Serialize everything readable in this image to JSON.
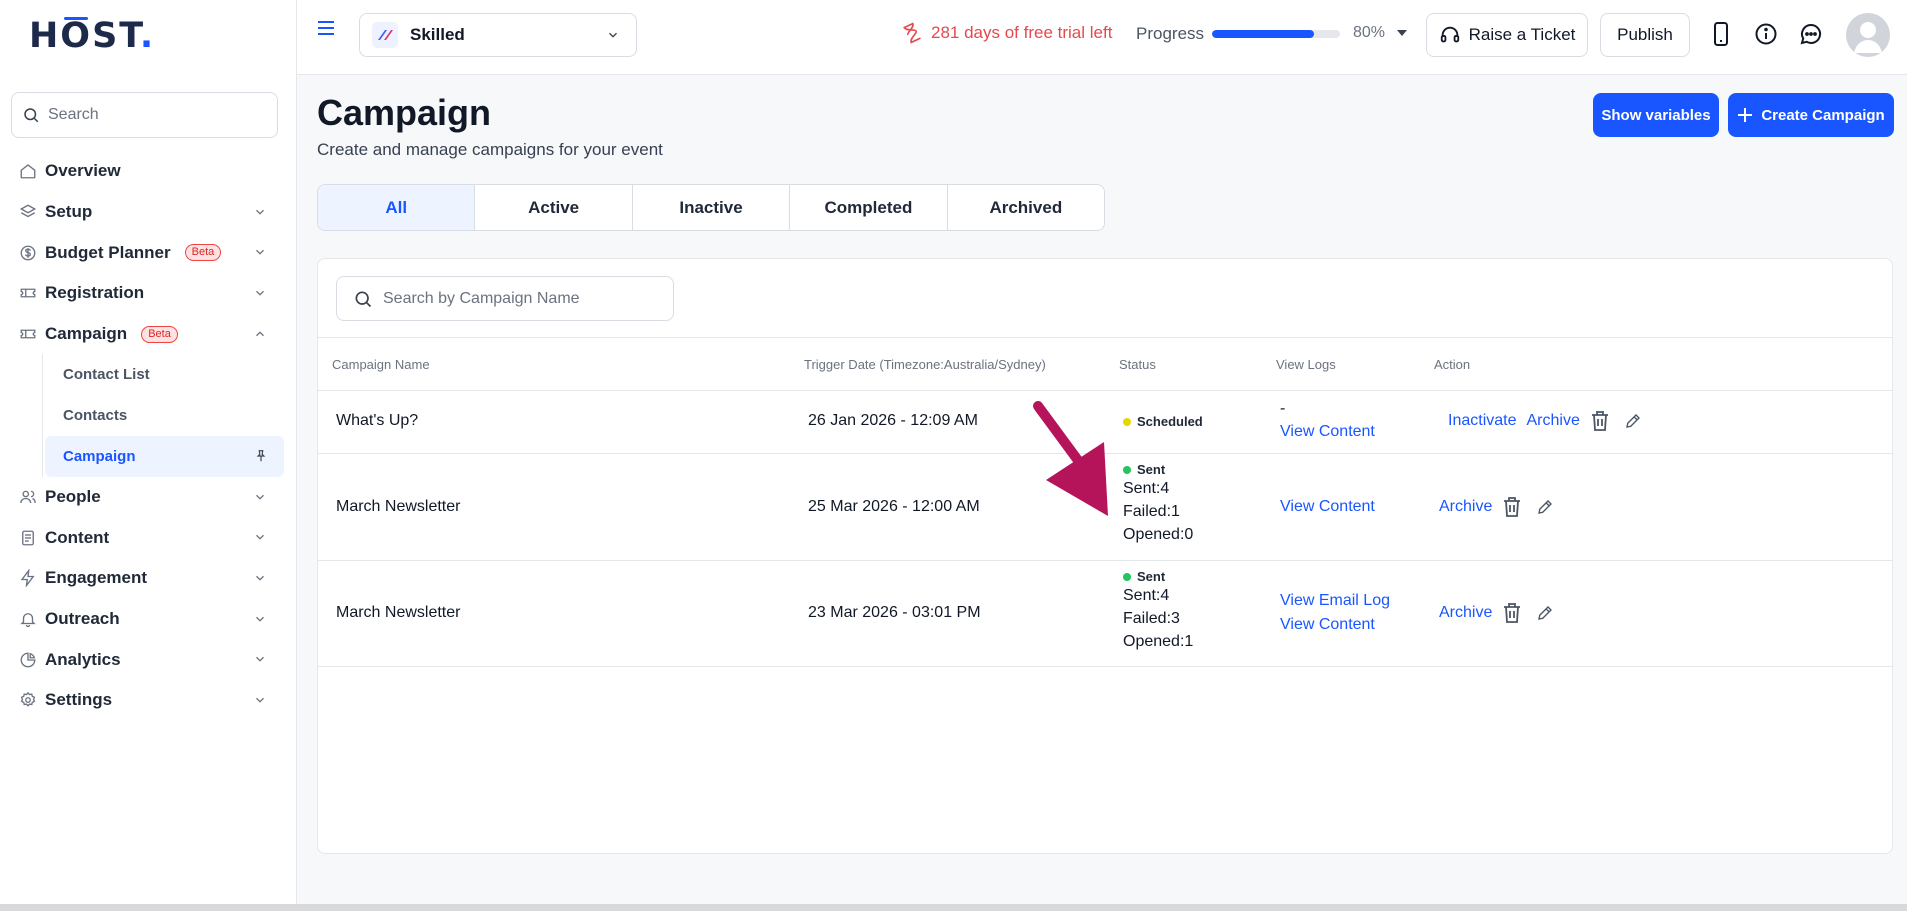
{
  "app": {
    "logo_text": "HOST",
    "logo_dot": "."
  },
  "sidebar": {
    "search_placeholder": "Search",
    "items": [
      {
        "label": "Overview",
        "icon": "home-icon"
      },
      {
        "label": "Setup",
        "icon": "layers-icon"
      },
      {
        "label": "Budget Planner",
        "icon": "dollar-icon",
        "badge": "Beta"
      },
      {
        "label": "Registration",
        "icon": "ticket-icon"
      },
      {
        "label": "Campaign",
        "icon": "ticket-icon",
        "badge": "Beta",
        "expanded": true
      },
      {
        "label": "People",
        "icon": "users-icon"
      },
      {
        "label": "Content",
        "icon": "document-icon"
      },
      {
        "label": "Engagement",
        "icon": "bolt-icon"
      },
      {
        "label": "Outreach",
        "icon": "bell-icon"
      },
      {
        "label": "Analytics",
        "icon": "pie-chart-icon"
      },
      {
        "label": "Settings",
        "icon": "gear-icon"
      }
    ],
    "campaign_sub": [
      {
        "label": "Contact List"
      },
      {
        "label": "Contacts"
      },
      {
        "label": "Campaign",
        "active": true
      }
    ]
  },
  "topbar": {
    "event_name": "Skilled",
    "trial_text": "281 days of free trial left",
    "progress_label": "Progress",
    "progress_value": 80,
    "progress_text": "80%",
    "raise_ticket": "Raise a Ticket",
    "publish": "Publish"
  },
  "page": {
    "title": "Campaign",
    "subtitle": "Create and manage campaigns for your event",
    "show_variables": "Show variables",
    "create_campaign": "Create Campaign"
  },
  "tabs": [
    {
      "label": "All",
      "active": true
    },
    {
      "label": "Active"
    },
    {
      "label": "Inactive"
    },
    {
      "label": "Completed"
    },
    {
      "label": "Archived"
    }
  ],
  "table": {
    "search_placeholder": "Search by Campaign Name",
    "headers": [
      "Campaign Name",
      "Trigger Date (Timezone:Australia/Sydney)",
      "Status",
      "View Logs",
      "Action"
    ],
    "rows": [
      {
        "name": "What's Up?",
        "date": "26 Jan 2026 - 12:09 AM",
        "status": "Scheduled",
        "status_color": "#e5d800",
        "logs_dash": "-",
        "logs": [
          "View Content"
        ],
        "actions": [
          "Inactivate",
          "Archive"
        ]
      },
      {
        "name": "March Newsletter",
        "date": "25 Mar 2026 - 12:00 AM",
        "status": "Sent",
        "status_color": "#22c55e",
        "sent": "Sent:4",
        "failed": "Failed:1",
        "opened": "Opened:0",
        "logs": [
          "View Content"
        ],
        "actions": [
          "Archive"
        ]
      },
      {
        "name": "March Newsletter",
        "date": "23 Mar 2026 - 03:01 PM",
        "status": "Sent",
        "status_color": "#22c55e",
        "sent": "Sent:4",
        "failed": "Failed:3",
        "opened": "Opened:1",
        "logs": [
          "View Email Log",
          "View Content"
        ],
        "actions": [
          "Archive"
        ]
      }
    ]
  },
  "colors": {
    "accent": "#1a56ff",
    "trial": "#e5484d",
    "annotation_arrow": "#b5145b"
  }
}
